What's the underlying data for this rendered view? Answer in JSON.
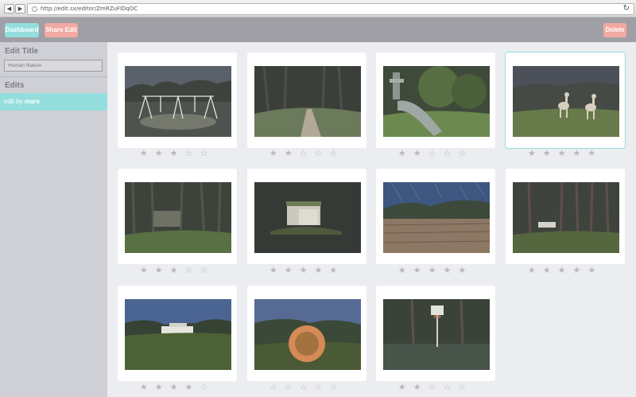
{
  "browser": {
    "url": "http://edit.sx/editor/ZmRZuFlDqOC",
    "back_glyph": "◀",
    "forward_glyph": "▶",
    "reload_glyph": "↻"
  },
  "header": {
    "dashboard_label": "Dashboard",
    "share_label": "Share Edit",
    "delete_label": "Delete"
  },
  "sidebar": {
    "edit_title_heading": "Edit Title",
    "edit_title_value": "Human Nature",
    "edits_heading": "Edits",
    "edit_item_prefix": "edit by",
    "edit_item_author": "mars"
  },
  "colors": {
    "accent": "#94dedd",
    "danger": "#f2a9a3",
    "header_bg": "#a09fa5",
    "sidebar_bg": "#cfcfd6",
    "canvas_bg": "#ebedf0"
  },
  "photos": [
    {
      "scene": "swingset-night",
      "rating": 3,
      "selected": false
    },
    {
      "scene": "forest-path-night",
      "rating": 2,
      "selected": false
    },
    {
      "scene": "pipe-in-grass",
      "rating": 2,
      "selected": false
    },
    {
      "scene": "deer-night",
      "rating": 5,
      "selected": true
    },
    {
      "scene": "forest-ruin",
      "rating": 3,
      "selected": false
    },
    {
      "scene": "glowing-shed",
      "rating": 5,
      "selected": false
    },
    {
      "scene": "wooden-deck-star-trails",
      "rating": 5,
      "selected": false
    },
    {
      "scene": "white-van-in-forest",
      "rating": 5,
      "selected": false
    },
    {
      "scene": "white-house-on-hill",
      "rating": 4,
      "selected": false
    },
    {
      "scene": "glowing-orb-night",
      "rating": 0,
      "selected": false
    },
    {
      "scene": "basketball-hoop-pond",
      "rating": 2,
      "selected": false
    }
  ],
  "rating_max": 5,
  "star_filled": "★",
  "star_empty": "☆"
}
